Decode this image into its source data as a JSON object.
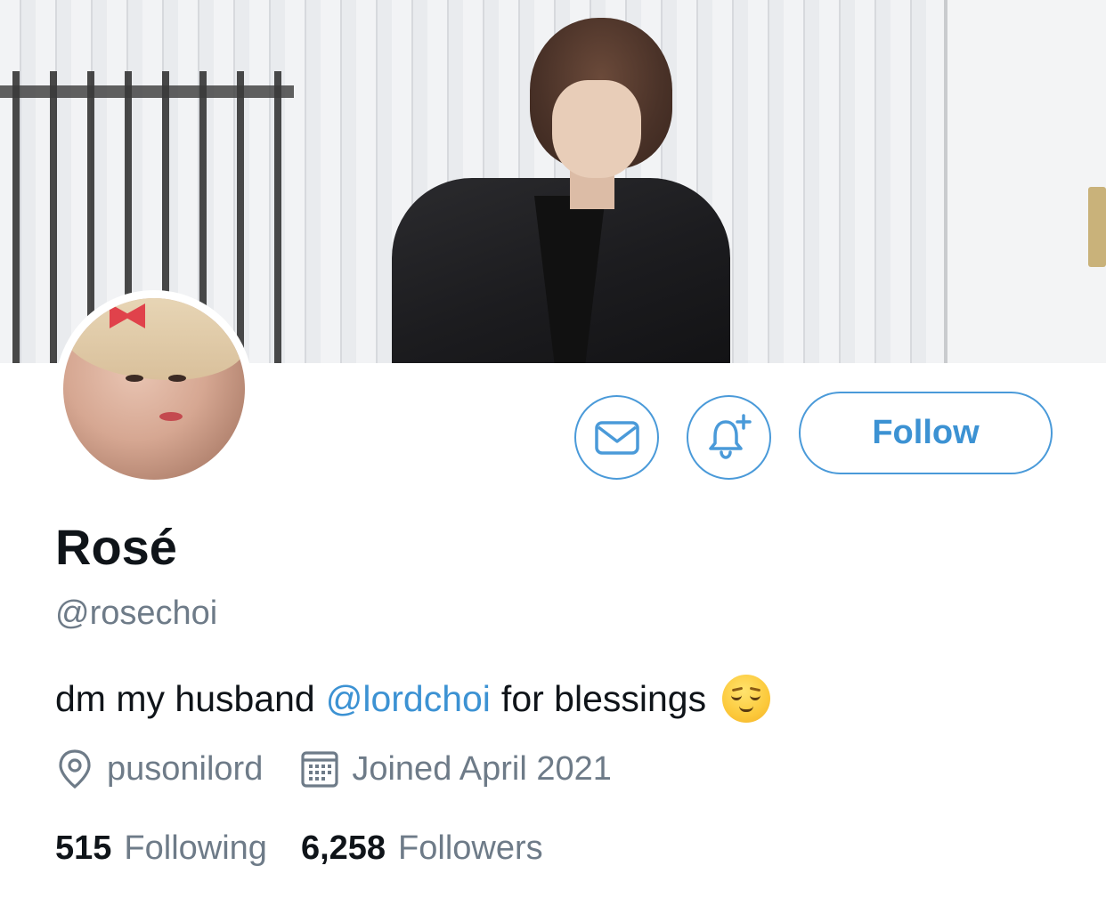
{
  "profile": {
    "display_name": "Rosé",
    "handle": "@rosechoi",
    "bio": {
      "before": "dm my husband",
      "mention": "@lordchoi",
      "after": "for blessings",
      "emoji": "relieved-face-emoji"
    },
    "location": "pusonilord",
    "joined": "Joined April 2021",
    "following_count": "515",
    "following_label": "Following",
    "followers_count": "6,258",
    "followers_label": "Followers"
  },
  "actions": {
    "message_icon": "envelope-icon",
    "notify_icon": "bell-plus-icon",
    "follow_label": "Follow"
  },
  "colors": {
    "accent": "#4a9ad9",
    "link": "#3c92d3",
    "secondary_text": "#6e7b88",
    "primary_text": "#0f1419"
  }
}
